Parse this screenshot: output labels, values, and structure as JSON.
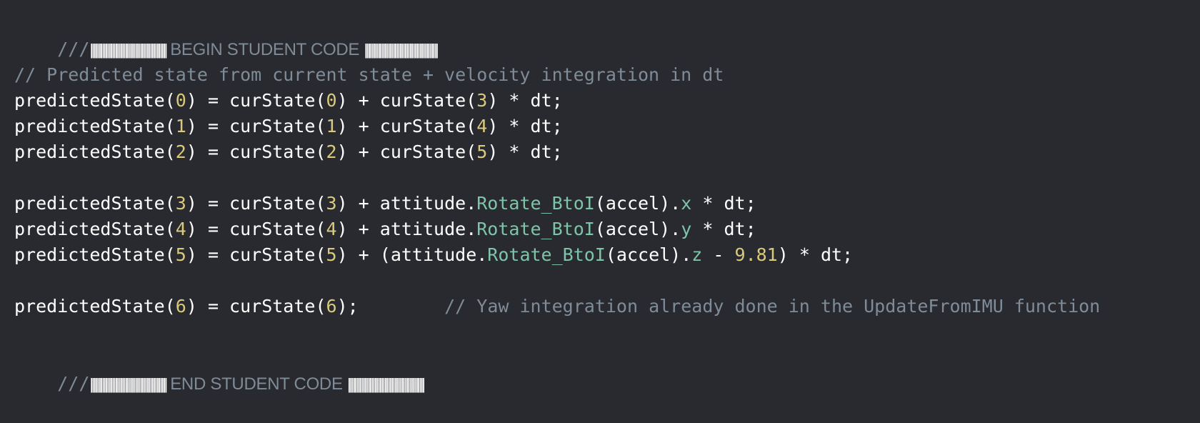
{
  "editor": {
    "begin_prefix": "///",
    "begin_bars_left": "||||||||||||||||||||||||||||||||||||||||||||||",
    "begin_marker": " BEGIN STUDENT CODE ",
    "begin_bars_right": "||||||||||||||||||||||||||||||||||||||||||||",
    "comment_1": "// Predicted state from current state + velocity integration in dt",
    "l1": {
      "a": "predictedState(",
      "n1": "0",
      "b": ") = curState(",
      "n2": "0",
      "c": ") + curState(",
      "n3": "3",
      "d": ") * dt;"
    },
    "l2": {
      "a": "predictedState(",
      "n1": "1",
      "b": ") = curState(",
      "n2": "1",
      "c": ") + curState(",
      "n3": "4",
      "d": ") * dt;"
    },
    "l3": {
      "a": "predictedState(",
      "n1": "2",
      "b": ") = curState(",
      "n2": "2",
      "c": ") + curState(",
      "n3": "5",
      "d": ") * dt;"
    },
    "l4": {
      "a": "predictedState(",
      "n1": "3",
      "b": ") = curState(",
      "n2": "3",
      "c": ") + attitude.",
      "fn": "Rotate_BtoI",
      "d": "(accel).",
      "m": "x",
      "e": " * dt;"
    },
    "l5": {
      "a": "predictedState(",
      "n1": "4",
      "b": ") = curState(",
      "n2": "4",
      "c": ") + attitude.",
      "fn": "Rotate_BtoI",
      "d": "(accel).",
      "m": "y",
      "e": " * dt;"
    },
    "l6": {
      "a": "predictedState(",
      "n1": "5",
      "b": ") = curState(",
      "n2": "5",
      "c": ") + (attitude.",
      "fn": "Rotate_BtoI",
      "d": "(accel).",
      "m": "z",
      "e": " - ",
      "n3": "9.81",
      "f": ") * dt;"
    },
    "l7": {
      "a": "predictedState(",
      "n1": "6",
      "b": ") = curState(",
      "n2": "6",
      "c": ");",
      "gap": "        ",
      "comment": "// Yaw integration already done in the UpdateFromIMU function"
    },
    "end_prefix": "///",
    "end_bars_left": "||||||||||||||||||||||||||||||||||||||||||||||",
    "end_marker": " END STUDENT CODE ",
    "end_bars_right": "||||||||||||||||||||||||||||||||||||||||||||||"
  }
}
